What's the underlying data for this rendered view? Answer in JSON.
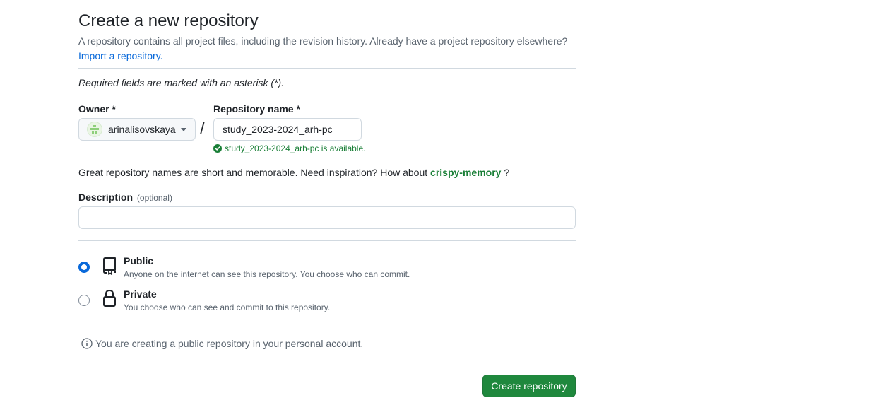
{
  "header": {
    "title": "Create a new repository",
    "subtitle": "A repository contains all project files, including the revision history. Already have a project repository elsewhere?",
    "import_link": "Import a repository."
  },
  "form": {
    "required_note": "Required fields are marked with an asterisk (*).",
    "owner_label": "Owner *",
    "owner_value": "arinalisovskaya",
    "slash": "/",
    "repo_name_label": "Repository name *",
    "repo_name_value": "study_2023-2024_arh-pc",
    "availability": "study_2023-2024_arh-pc is available.",
    "inspiration_prefix": "Great repository names are short and memorable. Need inspiration? How about",
    "inspiration_suggestion": "crispy-memory",
    "inspiration_suffix": "?",
    "description_label": "Description",
    "description_optional": "(optional)",
    "description_value": ""
  },
  "visibility": {
    "selected": "public",
    "options": [
      {
        "id": "public",
        "title": "Public",
        "description": "Anyone on the internet can see this repository. You choose who can commit.",
        "icon": "repo-icon"
      },
      {
        "id": "private",
        "title": "Private",
        "description": "You choose who can see and commit to this repository.",
        "icon": "lock-icon"
      }
    ]
  },
  "info_note": "You are creating a public repository in your personal account.",
  "actions": {
    "create_label": "Create repository"
  },
  "colors": {
    "accent": "#0969da",
    "success": "#1a7f37",
    "button": "#1f883d"
  }
}
